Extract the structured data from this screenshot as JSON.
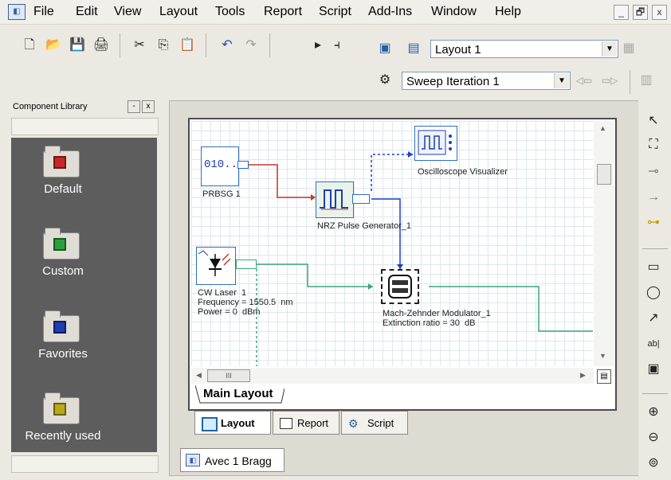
{
  "menubar": {
    "items": [
      "File",
      "Edit",
      "View",
      "Layout",
      "Tools",
      "Report",
      "Script",
      "Add-Ins",
      "Window",
      "Help"
    ],
    "window_buttons": [
      "_",
      "🗗",
      "x"
    ]
  },
  "toolbar": {
    "layout_select": "Layout 1",
    "sweep_select": "Sweep Iteration 1"
  },
  "library": {
    "title": "Component Library",
    "folders": [
      {
        "label": "Default",
        "color": "#c62828"
      },
      {
        "label": "Custom",
        "color": "#2e9e3c"
      },
      {
        "label": "Favorites",
        "color": "#1e3fb0"
      },
      {
        "label": "Recently used",
        "color": "#b9a817"
      }
    ]
  },
  "canvas": {
    "components": {
      "prbsg": {
        "icon_text": "010..",
        "label": "PRBSG 1"
      },
      "nrz": {
        "label": "NRZ Pulse Generator_1"
      },
      "scope": {
        "label": "Oscilloscope Visualizer"
      },
      "laser": {
        "label": "CW Laser  1",
        "freq": "Frequency = 1550.5  nm",
        "power": "Power = 0  dBm"
      },
      "mzm": {
        "label": "Mach-Zehnder Modulator_1",
        "extinction": "Extinction ratio = 30  dB"
      }
    },
    "hscroll_thumb": "III"
  },
  "tabs": {
    "main_layout": "Main Layout",
    "bottom": [
      "Layout",
      "Report",
      "Script"
    ],
    "document": "Avec 1 Bragg"
  },
  "colors": {
    "electrical": "#c0392b",
    "blue_link": "#1e3fd0",
    "optical": "#3aa57a"
  }
}
